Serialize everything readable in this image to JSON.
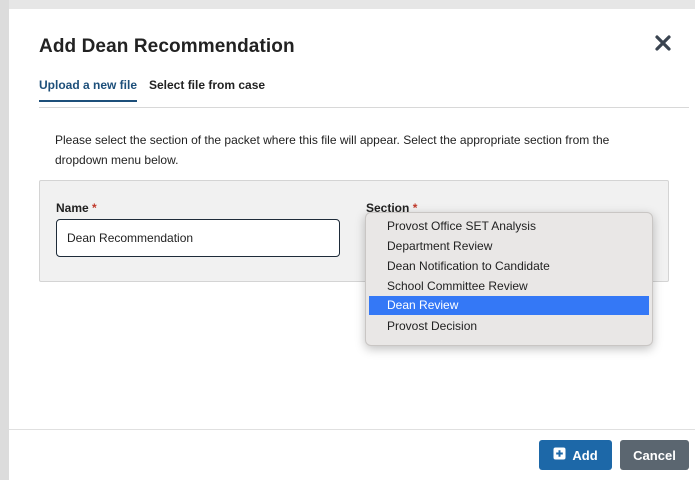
{
  "modal": {
    "title": "Add Dean Recommendation",
    "close_icon": "close-x-icon"
  },
  "tabs": [
    {
      "label": "Upload a new file",
      "active": true
    },
    {
      "label": "Select file from case",
      "active": false
    }
  ],
  "instructions": "Please select the section of the packet where this file will appear. Select the appropriate section from the dropdown menu below.",
  "form": {
    "name_label": "Name",
    "name_required": "*",
    "name_value": "Dean Recommendation",
    "section_label": "Section",
    "section_required": "*"
  },
  "dropdown": {
    "options": [
      "Provost Office SET Analysis",
      "Department Review",
      "Dean Notification to Candidate",
      "School Committee Review",
      "Dean Review",
      "Provost Decision"
    ],
    "selected": "Dean Review"
  },
  "footer": {
    "add_label": "Add",
    "add_icon": "plus-square-icon",
    "cancel_label": "Cancel"
  },
  "colors": {
    "primary": "#1d68a8",
    "secondary": "#5b6670",
    "tab_active": "#1d4f7a",
    "selection": "#3478f6",
    "required": "#c0392b"
  }
}
